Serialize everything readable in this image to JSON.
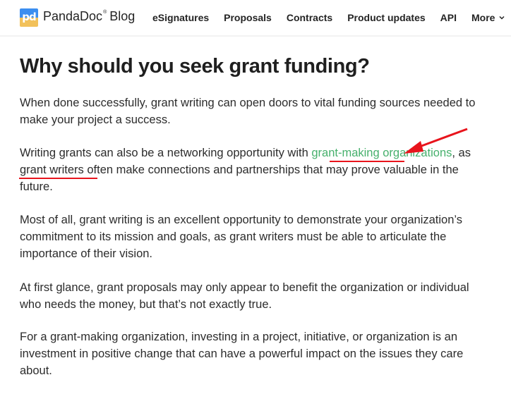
{
  "header": {
    "brand_name": "PandaDoc",
    "brand_mark": "®",
    "brand_suffix": "Blog",
    "logo_glyph": "pd",
    "nav": [
      {
        "label": "eSignatures"
      },
      {
        "label": "Proposals"
      },
      {
        "label": "Contracts"
      },
      {
        "label": "Product updates"
      },
      {
        "label": "API"
      },
      {
        "label": "More",
        "icon": "chevron-down-icon"
      }
    ]
  },
  "article": {
    "heading": "Why should you seek grant funding?",
    "paragraphs": {
      "p1": "When done successfully, grant writing can open doors to vital funding sources needed to make your project a success.",
      "p2_before": "Writing grants can also be a networking opportunity with ",
      "p2_link": "grant-making organizations",
      "p2_after": ", as grant writers often make connections and partnerships that may prove valuable in the future.",
      "p3": "Most of all, grant writing is an excellent opportunity to demonstrate your organization’s commitment to its mission and goals, as grant writers must be able to articulate the importance of their vision.",
      "p4": "At first glance, grant proposals may only appear to benefit the organization or individual who needs the money, but that’s not exactly true.",
      "p5": "For a grant-making organization, investing in a project, initiative, or organization is an investment in positive change that can have a powerful impact on the issues they care about."
    }
  },
  "colors": {
    "link": "#46b06c",
    "annotation": "#e8141c",
    "logo_blue": "#3b8ef0",
    "logo_yellow": "#f2c15a"
  }
}
